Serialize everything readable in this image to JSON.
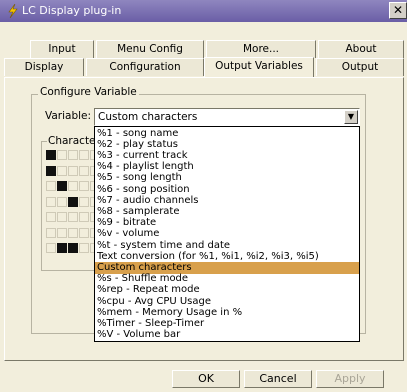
{
  "window": {
    "title": "LC Display plug-in",
    "close_glyph": "✕"
  },
  "tabs_top": [
    "Input",
    "Menu Config",
    "More...",
    "About"
  ],
  "tabs_bottom": [
    "Display",
    "Configuration",
    "Output Variables",
    "Output"
  ],
  "active_tab": "Output Variables",
  "group": {
    "legend": "Configure Variable"
  },
  "variable": {
    "label": "Variable:",
    "value": "Custom characters"
  },
  "characters_group": {
    "legend": "Characte"
  },
  "dropdown_options": [
    "%1 - song name",
    "%2 - play status",
    "%3 - current track",
    "%4 - playlist length",
    "%5 - song length",
    "%6 - song position",
    "%7 - audio channels",
    "%8 - samplerate",
    "%9 - bitrate",
    "%v - volume",
    "%t - system time and date",
    "Text conversion (for %1, %i1, %i2, %i3, %i5)",
    "Custom characters",
    "%s - Shuffle mode",
    "%rep - Repeat mode",
    "%cpu - Avg CPU Usage",
    "%mem - Memory Usage in %",
    "%Timer - Sleep-Timer",
    "%V - Volume bar"
  ],
  "selected_index": 12,
  "buttons": {
    "ok": "OK",
    "cancel": "Cancel",
    "apply": "Apply"
  },
  "colors": {
    "accent_selected": "#d8a04c",
    "titlebar": "#6a5ea6"
  }
}
